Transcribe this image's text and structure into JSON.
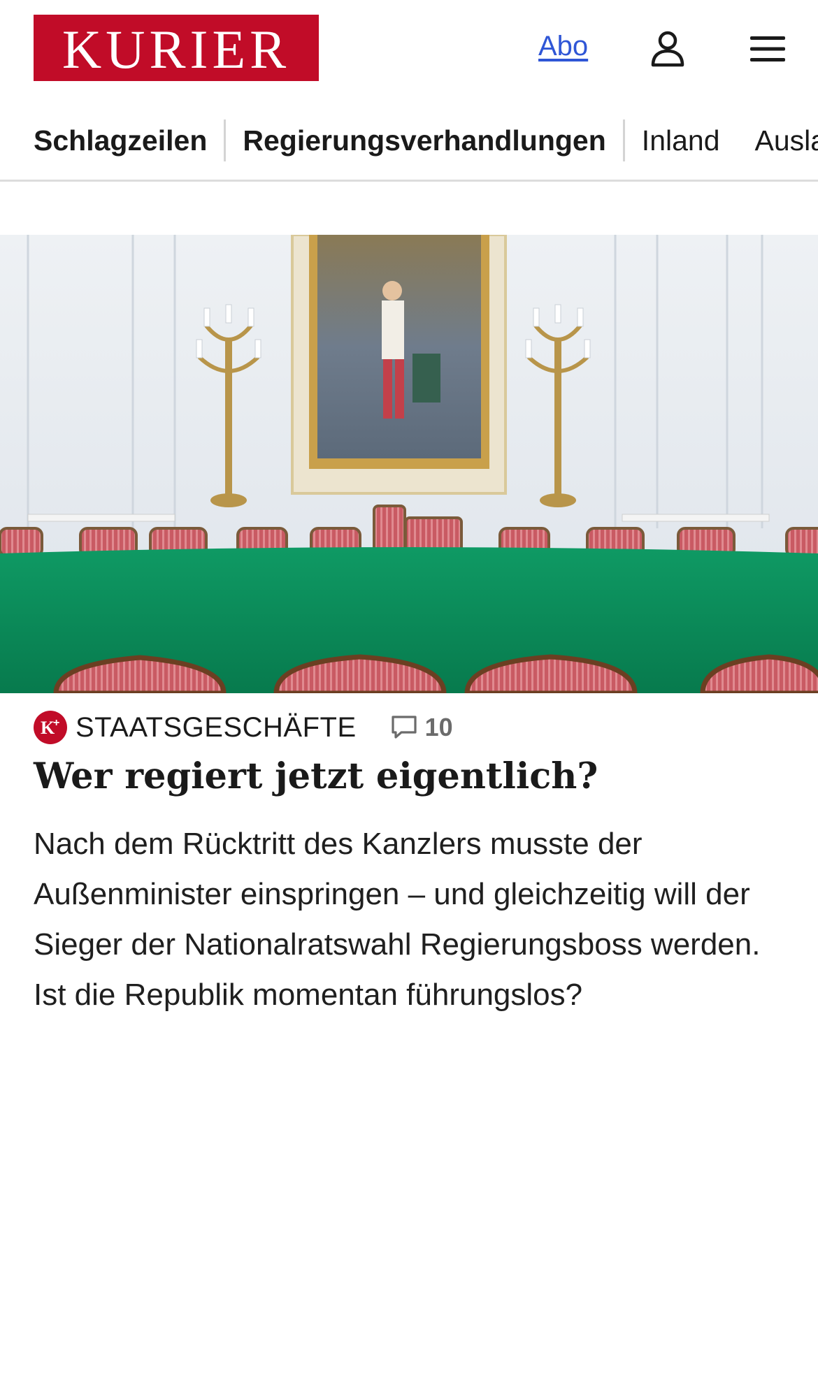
{
  "header": {
    "logo_text": "KURIER",
    "abo_label": "Abo",
    "user_icon": "user-icon",
    "menu_icon": "hamburger-menu-icon",
    "brand_color": "#c10c28",
    "link_color": "#2f56d6"
  },
  "nav": {
    "items": [
      {
        "label": "Schlagzeilen"
      },
      {
        "label": "Regierungsverhandlungen"
      },
      {
        "label": "Inland"
      },
      {
        "label": "Ausland"
      }
    ]
  },
  "article": {
    "hero_icon": "state-room-photo",
    "badge_text": "K+",
    "category": "STAATSGESCHÄFTE",
    "comment_icon": "comment-icon",
    "comment_count": "10",
    "headline": "Wer regiert jetzt eigentlich?",
    "teaser": "Nach dem Rücktritt des Kanzlers musste der Außenminister einspringen – und gleichzeitig will der Sieger der Nationalratswahl Regierungsboss werden. Ist die Republik momentan führungslos?"
  }
}
